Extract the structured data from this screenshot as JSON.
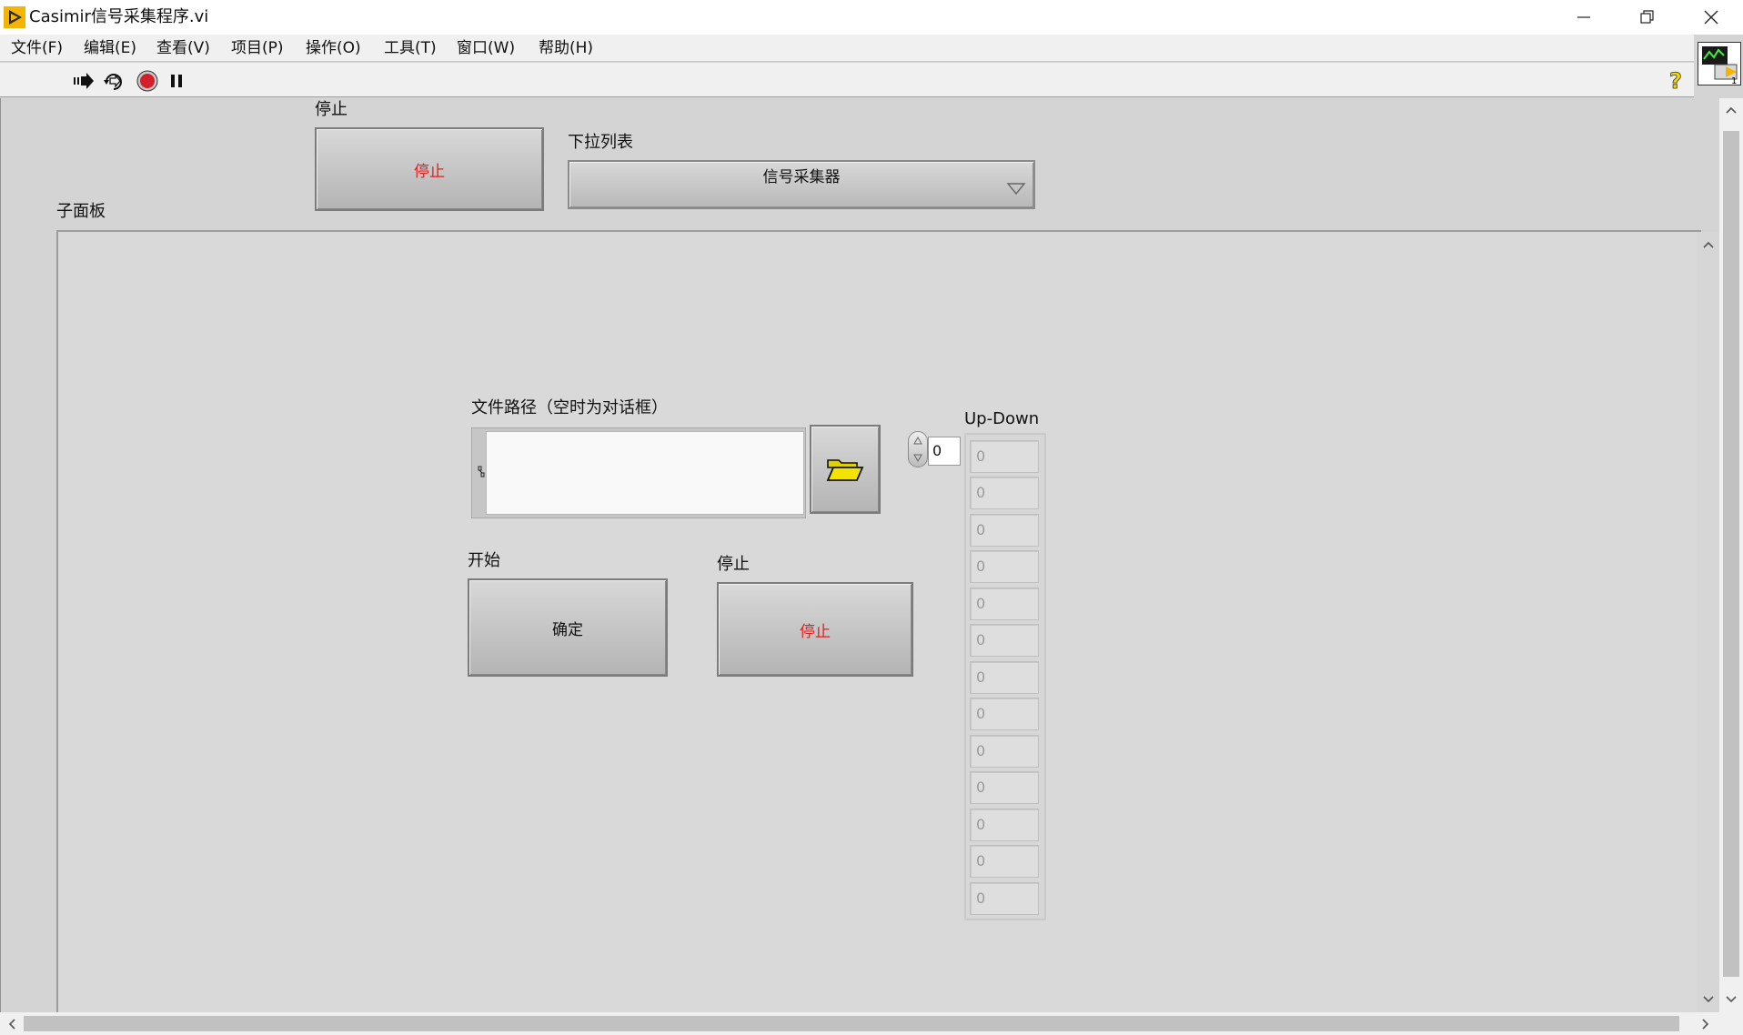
{
  "window": {
    "title": "Casimir信号采集程序.vi",
    "controls": [
      "minimize-icon",
      "restore-icon",
      "close-icon"
    ]
  },
  "menu": [
    "文件(F)",
    "编辑(E)",
    "查看(V)",
    "项目(P)",
    "操作(O)",
    "工具(T)",
    "窗口(W)",
    "帮助(H)"
  ],
  "toolbar": {
    "icons": [
      "run-arrow-icon",
      "run-continuously-icon",
      "abort-icon",
      "pause-icon"
    ],
    "help_icon": "help-icon"
  },
  "front_panel": {
    "stop_label": "停止",
    "stop_button_text": "停止",
    "dropdown_label": "下拉列表",
    "dropdown_value": "信号采集器",
    "subpanel_label": "子面板"
  },
  "subpanel": {
    "path_label": "文件路径（空时为对话框）",
    "path_value": "",
    "start_label": "开始",
    "start_button_text": "确定",
    "stop_label": "停止",
    "stop_button_text": "停止",
    "array_label": "Up-Down",
    "array_index": "0",
    "array_values": [
      "0",
      "0",
      "0",
      "0",
      "0",
      "0",
      "0",
      "0",
      "0",
      "0",
      "0",
      "0",
      "0"
    ]
  },
  "colors": {
    "stop_text": "#e81c1c",
    "panel_bg": "#d4d4d4",
    "folder_icon": "#f2e300"
  }
}
